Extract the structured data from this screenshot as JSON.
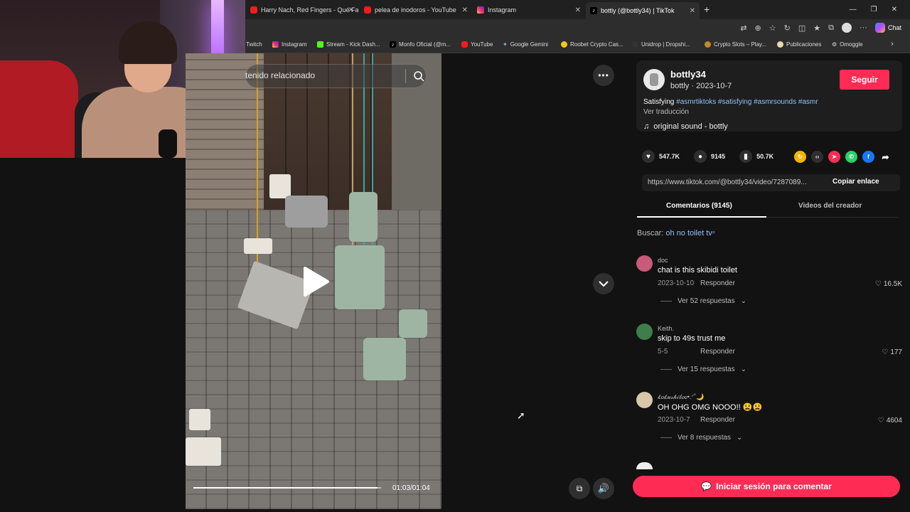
{
  "browser": {
    "tabs": [
      {
        "label": "Harry Nach, Red Fingers - Qué Fac",
        "icon": "youtube-icon"
      },
      {
        "label": "pelea de inodoros - YouTube",
        "icon": "youtube-icon"
      },
      {
        "label": "Instagram",
        "icon": "instagram-icon"
      },
      {
        "label": "bottly (@bottly34) | TikTok",
        "icon": "tiktok-icon"
      }
    ],
    "new_tab": "+",
    "chat_label": "Chat"
  },
  "bookmarks": [
    {
      "label": "Twitch"
    },
    {
      "label": "Instagram"
    },
    {
      "label": "Stream - Kick Dash..."
    },
    {
      "label": "Monfo Oficial (@m..."
    },
    {
      "label": "YouTube"
    },
    {
      "label": "Google Gemini"
    },
    {
      "label": "Roobet Crypto Cas..."
    },
    {
      "label": "Unidrop | Dropshi..."
    },
    {
      "label": "Crypto Slots – Play..."
    },
    {
      "label": "Publicaciones"
    },
    {
      "label": "Omoggle"
    }
  ],
  "video": {
    "search_placeholder": "tenido relacionado",
    "time": "01:03/01:04",
    "progress": 0.98
  },
  "creator": {
    "username": "bottly34",
    "name": "bottly",
    "date": "2023-10-7",
    "follow_label": "Seguir",
    "caption": "Satisfying",
    "hashtags": [
      "#asmrtiktoks",
      "#satisfying",
      "#asmrsounds",
      "#asmr"
    ],
    "translate": "Ver traducción",
    "sound": "original sound - bottly"
  },
  "stats": {
    "likes": "547.7K",
    "comments": "9145",
    "saves": "50.7K"
  },
  "share": {
    "url": "https://www.tiktok.com/@bottly34/video/7287089...",
    "copy_label": "Copiar enlace"
  },
  "tabs": {
    "comments": "Comentarios (9145)",
    "creator_videos": "Videos del creador"
  },
  "search_hint": {
    "label": "Buscar:",
    "query": "oh no toilet tv"
  },
  "comments": [
    {
      "user": "doc",
      "text": "chat is this skibidi toilet",
      "date": "2023-10-10",
      "reply": "Responder",
      "likes": "16.5K",
      "more": "Ver 52 respuestas",
      "color": "#c85a7a"
    },
    {
      "user": "Keith.",
      "text": "skip to 49s trust me",
      "date": "5-5",
      "reply": "Responder",
      "likes": "177",
      "more": "Ver 15 respuestas",
      "color": "#3f7d4a"
    },
    {
      "user": "𝓀𝑜𝓀𝓊𝓈𝒽𝒾𝒷𝑜𝑜•.ᐟ˚🌙",
      "text": "OH OHG OMG NOOO!! 😫😫",
      "date": "2023-10-7",
      "reply": "Responder",
      "likes": "4604",
      "more": "Ver 8 respuestas",
      "color": "#d8c8a8"
    }
  ],
  "login_label": "Iniciar sesión para comentar"
}
